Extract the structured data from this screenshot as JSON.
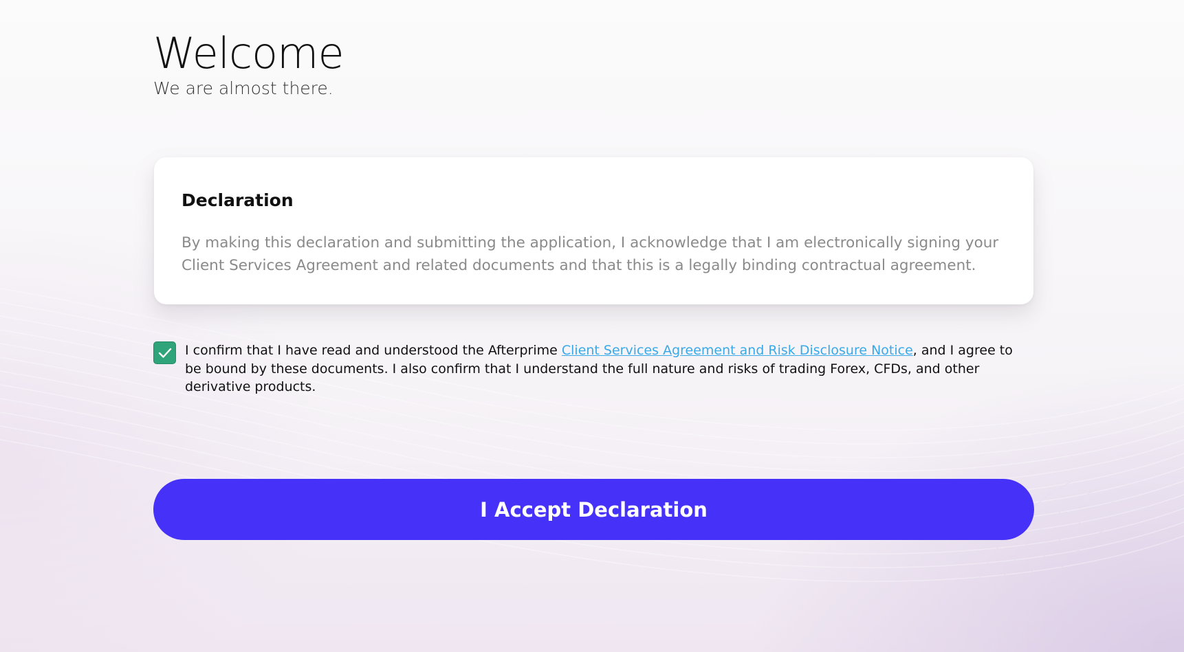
{
  "header": {
    "title": "Welcome",
    "subtitle": "We are almost there."
  },
  "declaration": {
    "title": "Declaration",
    "body": "By making this declaration and submitting the application, I acknowledge that I am electronically signing your Client Services Agreement and related documents and that this is a legally binding contractual agreement."
  },
  "confirmation": {
    "checked": true,
    "text_before": "I confirm that I have read and understood the Afterprime ",
    "link_text": "Client Services Agreement and Risk Disclosure Notice",
    "text_after": ", and I agree to be bound by these documents. I also confirm that I understand the full nature and risks of trading Forex, CFDs, and other derivative products."
  },
  "actions": {
    "accept_label": "I Accept Declaration"
  },
  "colors": {
    "accent": "#4531f7",
    "checkbox": "#2fa37a",
    "link": "#3aa9e8",
    "muted_text": "#8a8a8a"
  },
  "icons": {
    "checkbox_mark": "check-icon"
  }
}
